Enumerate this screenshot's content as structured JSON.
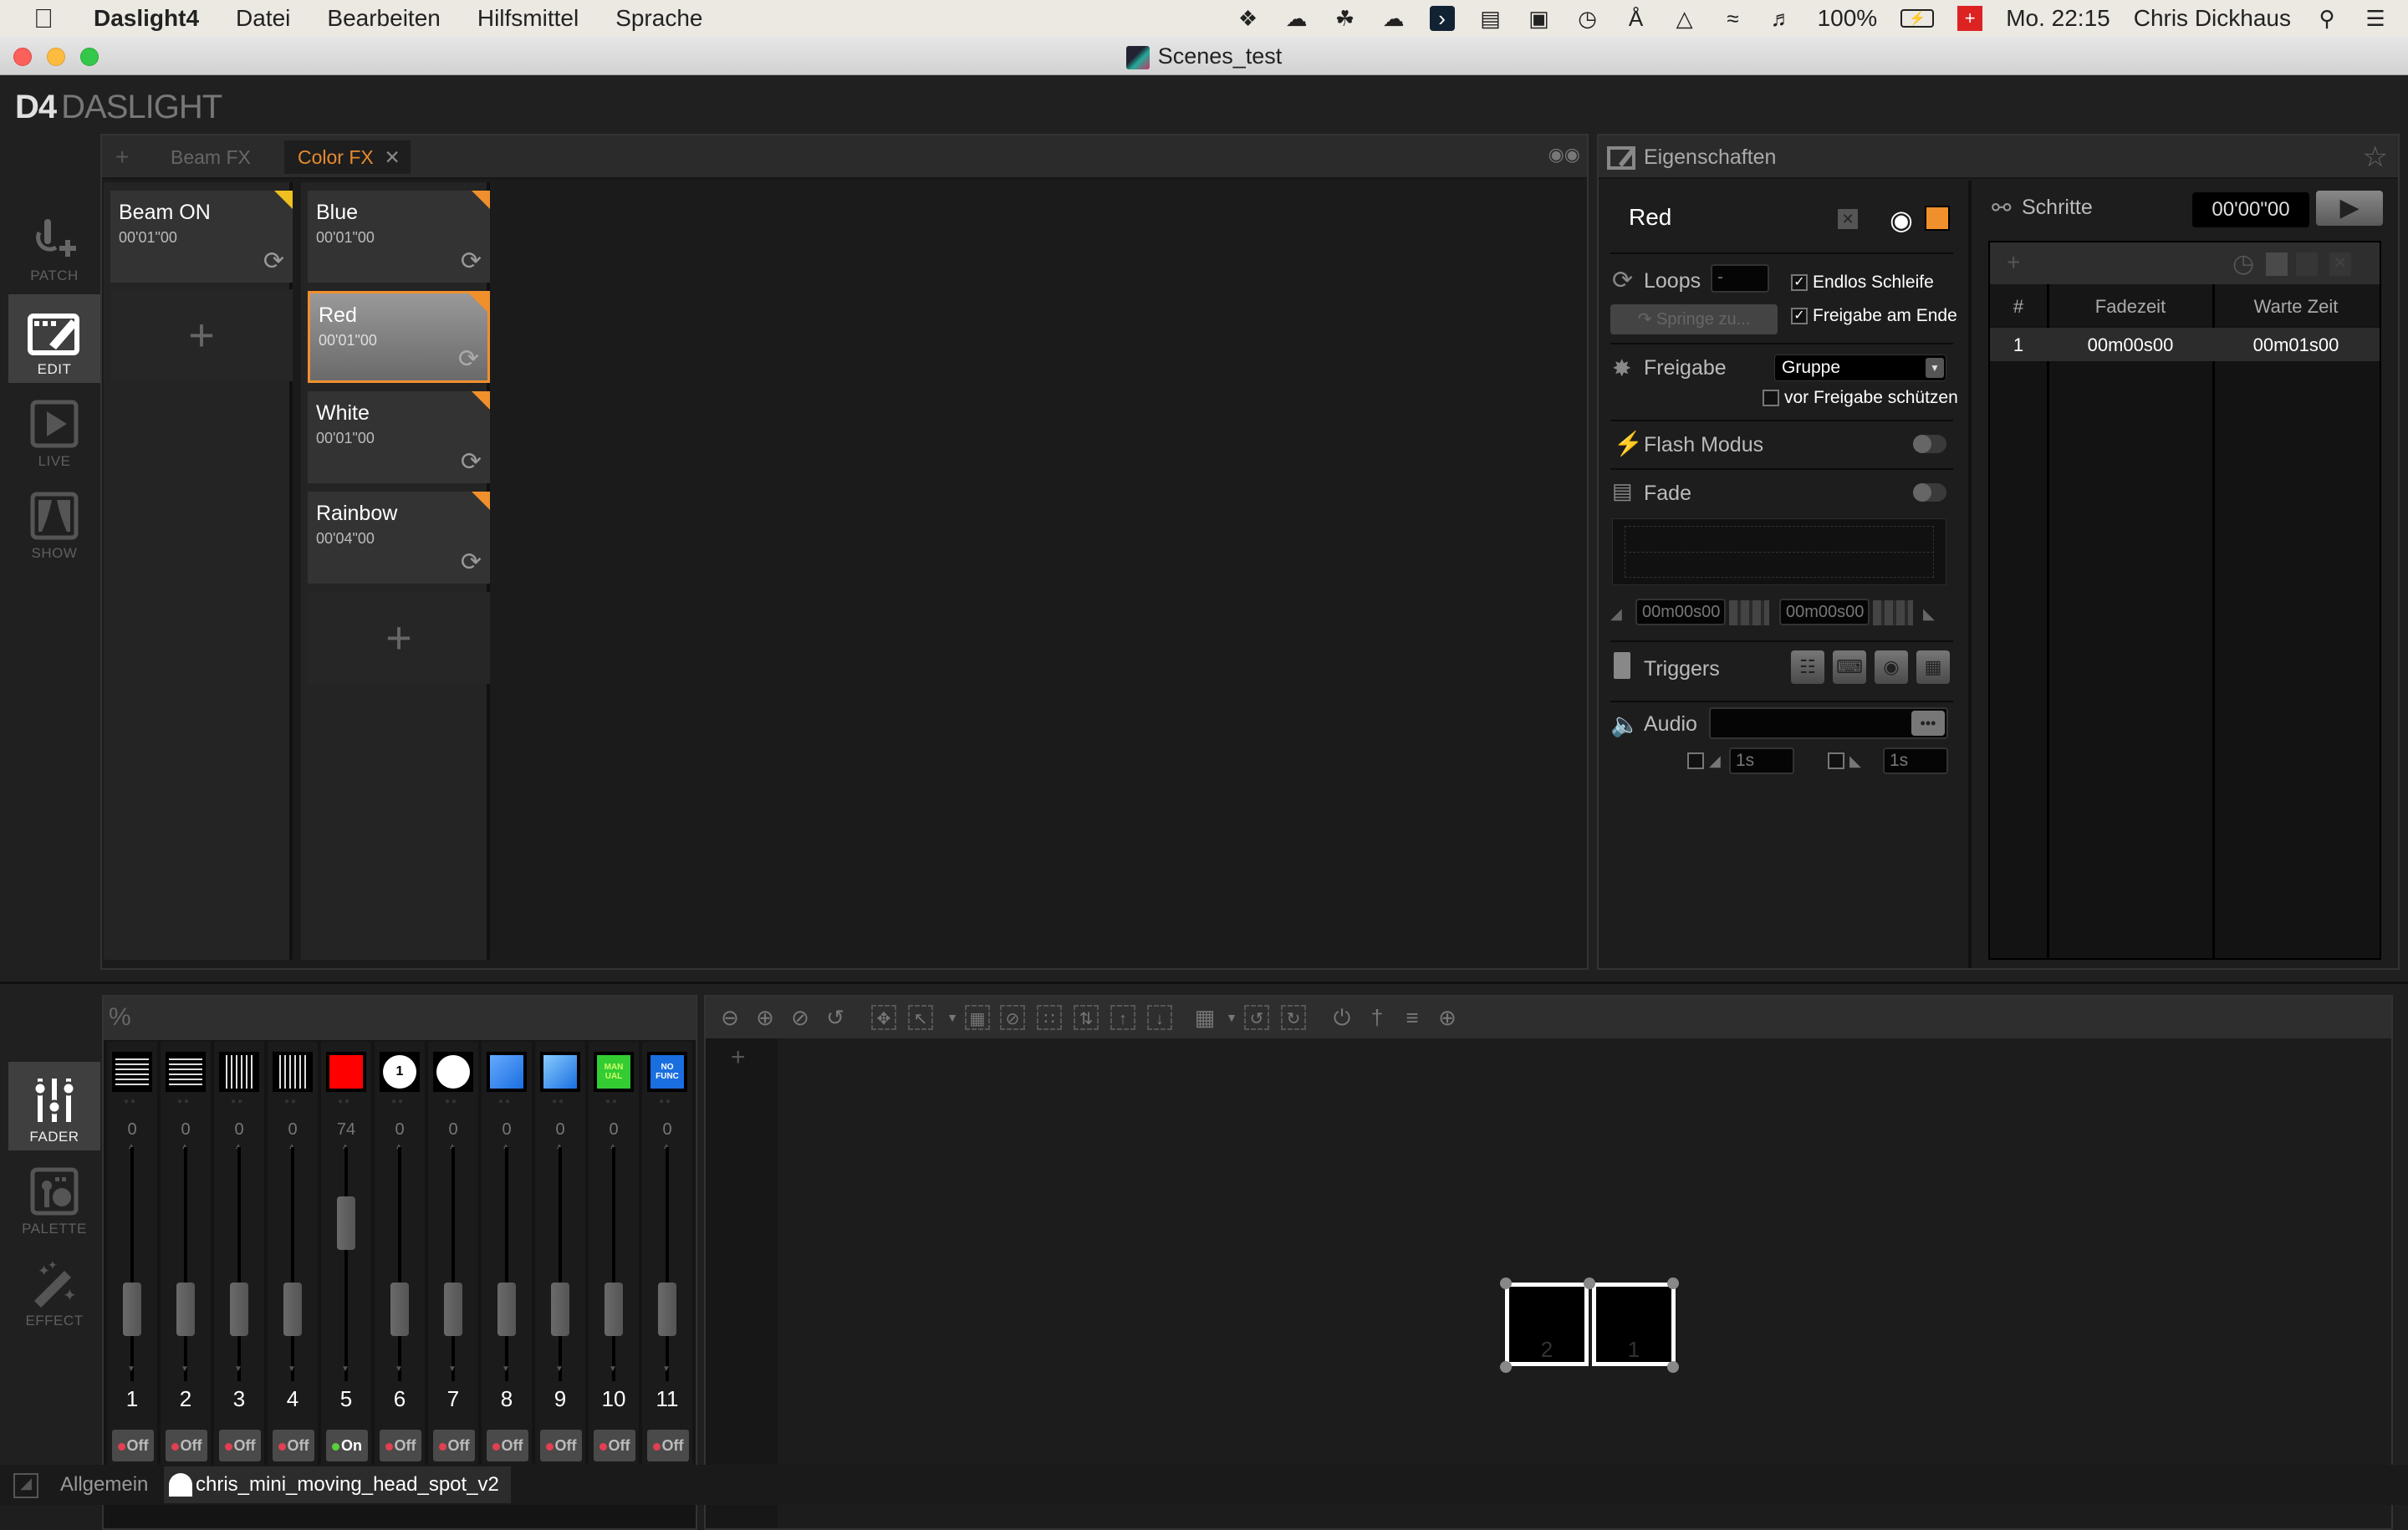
{
  "menubar": {
    "app_name": "Daslight4",
    "menus": [
      "Datei",
      "Bearbeiten",
      "Hilfsmittel",
      "Sprache"
    ],
    "status_icons": [
      "dropbox-icon",
      "onedrive-icon",
      "evernote-icon",
      "cloud-upload-icon",
      "dashlane-icon",
      "clipboard-icon",
      "camera-icon",
      "time-machine-icon",
      "bluetooth-icon",
      "airplay-icon",
      "wifi-icon",
      "volume-icon"
    ],
    "battery": "100%",
    "clock": "Mo. 22:15",
    "user": "Chris Dickhaus"
  },
  "window": {
    "title": "Scenes_test"
  },
  "logo": {
    "mark": "D4",
    "text": "DASLIGHT"
  },
  "sidebar_top": [
    {
      "label": "PATCH",
      "active": false
    },
    {
      "label": "EDIT",
      "active": true
    },
    {
      "label": "LIVE",
      "active": false
    },
    {
      "label": "SHOW",
      "active": false
    }
  ],
  "sidebar_bottom": [
    {
      "label": "FADER",
      "active": true
    },
    {
      "label": "PALETTE",
      "active": false
    },
    {
      "label": "EFFECT",
      "active": false
    }
  ],
  "scenes_panel": {
    "tabs": [
      {
        "label": "Beam FX",
        "active": false
      },
      {
        "label": "Color FX",
        "active": true
      }
    ],
    "columns": [
      {
        "scenes": [
          {
            "name": "Beam ON",
            "time": "00'01\"00",
            "corner": "#f0c020",
            "selected": false
          }
        ]
      },
      {
        "scenes": [
          {
            "name": "Blue",
            "time": "00'01\"00",
            "corner": "#f0902c",
            "selected": false
          },
          {
            "name": "Red",
            "time": "00'01\"00",
            "corner": "#f0902c",
            "selected": true
          },
          {
            "name": "White",
            "time": "00'01\"00",
            "corner": "#f0902c",
            "selected": false
          },
          {
            "name": "Rainbow",
            "time": "00'04\"00",
            "corner": "#f0902c",
            "selected": false
          }
        ]
      }
    ]
  },
  "properties": {
    "title": "Eigenschaften",
    "scene_name": "Red",
    "scene_color": "#f0902c",
    "loops_label": "Loops",
    "loops_value": "-",
    "jump_button": "Springe zu...",
    "endless_loop": {
      "label": "Endlos Schleife",
      "checked": true
    },
    "release_at_end": {
      "label": "Freigabe am Ende",
      "checked": true
    },
    "release_label": "Freigabe",
    "release_value": "Gruppe",
    "protect_release": {
      "label": "vor Freigabe schützen",
      "checked": false
    },
    "flash_label": "Flash Modus",
    "flash_on": false,
    "fade_label": "Fade",
    "fade_on": false,
    "fade_in": "00m00s00",
    "fade_out": "00m00s00",
    "triggers_label": "Triggers",
    "audio_label": "Audio",
    "audio_file": "",
    "audio_fade_in": "1s",
    "audio_fade_out": "1s"
  },
  "steps": {
    "title": "Schritte",
    "time": "00'00\"00",
    "columns": [
      "#",
      "Fadezeit",
      "Warte Zeit"
    ],
    "rows": [
      {
        "n": "1",
        "fade": "00m00s00",
        "wait": "00m01s00"
      }
    ]
  },
  "fader": {
    "header_icon": "%",
    "channels": [
      {
        "num": "1",
        "value": 0,
        "icon": "pan-icon",
        "on": false
      },
      {
        "num": "2",
        "value": 0,
        "icon": "pan-fine-icon",
        "on": false
      },
      {
        "num": "3",
        "value": 0,
        "icon": "tilt-icon",
        "on": false
      },
      {
        "num": "4",
        "value": 0,
        "icon": "tilt-fine-icon",
        "on": false
      },
      {
        "num": "5",
        "value": 74,
        "icon": "color-red-icon",
        "on": true
      },
      {
        "num": "6",
        "value": 0,
        "icon": "gobo-icon",
        "on": false
      },
      {
        "num": "7",
        "value": 0,
        "icon": "shutter-icon",
        "on": false
      },
      {
        "num": "8",
        "value": 0,
        "icon": "beam-icon",
        "on": false
      },
      {
        "num": "9",
        "value": 0,
        "icon": "prism-icon",
        "on": false
      },
      {
        "num": "10",
        "value": 0,
        "icon": "manual-icon",
        "on": false
      },
      {
        "num": "11",
        "value": 0,
        "icon": "no-func-icon",
        "on": false
      }
    ],
    "on_label": "On",
    "off_label": "Off"
  },
  "stage": {
    "fixtures": [
      {
        "label": "2"
      },
      {
        "label": "1"
      }
    ]
  },
  "bottom_tabs": [
    {
      "label": "Allgemein",
      "active": false
    },
    {
      "label": "chris_mini_moving_head_spot_v2",
      "active": true
    }
  ]
}
